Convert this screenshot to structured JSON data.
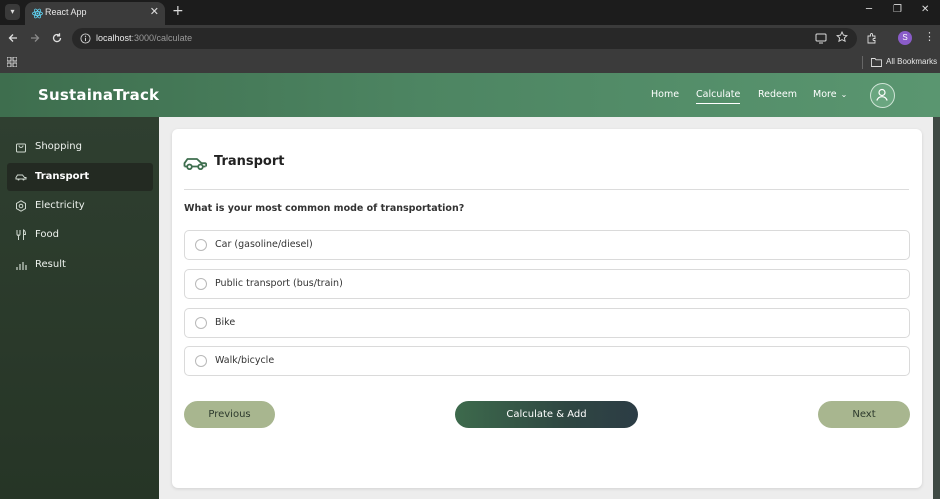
{
  "browser": {
    "tab_title": "React App",
    "tab_close": "✕",
    "new_tab": "+",
    "url_host": "localhost",
    "url_path": ":3000/calculate",
    "profile_initial": "S",
    "bookmarks_label": "All Bookmarks",
    "window_controls": [
      "─",
      "❐",
      "✕"
    ]
  },
  "navbar": {
    "brand": "SustainaTrack",
    "links": [
      {
        "label": "Home"
      },
      {
        "label": "Calculate",
        "active": true
      },
      {
        "label": "Redeem"
      },
      {
        "label": "More",
        "chevron": "⌄"
      }
    ]
  },
  "sidebar": {
    "items": [
      {
        "label": "Shopping",
        "icon": "bag-icon"
      },
      {
        "label": "Transport",
        "icon": "car-icon",
        "active": true
      },
      {
        "label": "Electricity",
        "icon": "electricity-icon"
      },
      {
        "label": "Food",
        "icon": "utensils-icon"
      },
      {
        "label": "Result",
        "icon": "bar-chart-icon"
      }
    ]
  },
  "card": {
    "title": "Transport",
    "icon": "car-icon",
    "question": "What is your most common mode of transportation?",
    "options": [
      {
        "label": "Car (gasoline/diesel)",
        "selected": false
      },
      {
        "label": "Public transport (bus/train)",
        "selected": false
      },
      {
        "label": "Bike",
        "selected": false
      },
      {
        "label": "Walk/bicycle",
        "selected": false
      }
    ],
    "buttons": {
      "previous": "Previous",
      "calculate": "Calculate & Add",
      "next": "Next"
    }
  },
  "colors": {
    "nav_gradient_start": "#3e6e4e",
    "nav_gradient_end": "#5a9670",
    "sidebar_bg": "#2f3f30",
    "button_secondary": "#a8b68f",
    "button_primary_start": "#3d6a4c",
    "button_primary_end": "#2c3c45",
    "card_icon": "#3e6e4e"
  }
}
